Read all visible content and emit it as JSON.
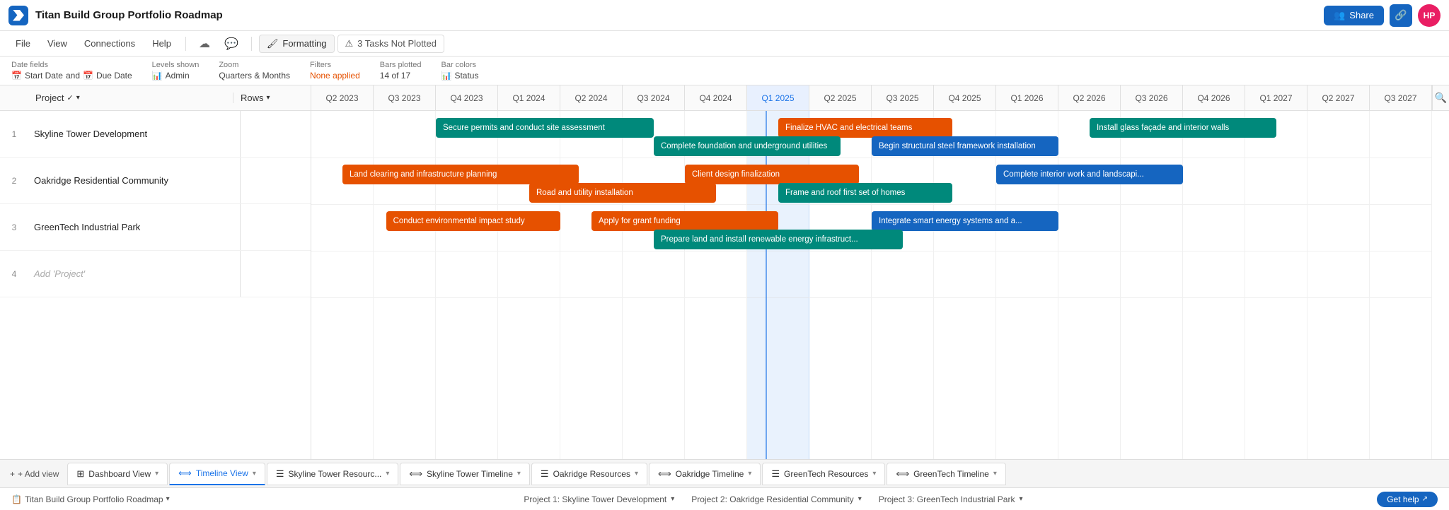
{
  "app": {
    "title": "Titan Build Group Portfolio Roadmap",
    "logo_alt": "App Logo"
  },
  "topbar": {
    "share_label": "Share",
    "avatar_initials": "HP"
  },
  "menubar": {
    "file": "File",
    "view": "View",
    "connections": "Connections",
    "help": "Help",
    "formatting": "Formatting",
    "not_plotted": "3 Tasks Not Plotted"
  },
  "infobar": {
    "date_fields_label": "Date fields",
    "date_fields_value": "Start Date",
    "date_fields_and": "and",
    "date_fields_due": "Due Date",
    "levels_label": "Levels shown",
    "levels_value": "Admin",
    "zoom_label": "Zoom",
    "zoom_value": "Quarters & Months",
    "filters_label": "Filters",
    "filters_value": "None applied",
    "bars_plotted_label": "Bars plotted",
    "bars_plotted_value": "14 of 17",
    "bar_colors_label": "Bar colors",
    "bar_colors_value": "Status"
  },
  "gantt": {
    "col_project": "Project",
    "col_rows": "Rows",
    "quarters": [
      {
        "label": "Q2 2023",
        "current": false
      },
      {
        "label": "Q3 2023",
        "current": false
      },
      {
        "label": "Q4 2023",
        "current": false
      },
      {
        "label": "Q1 2024",
        "current": false
      },
      {
        "label": "Q2 2024",
        "current": false
      },
      {
        "label": "Q3 2024",
        "current": false
      },
      {
        "label": "Q4 2024",
        "current": false
      },
      {
        "label": "Q1 2025",
        "current": true
      },
      {
        "label": "Q2 2025",
        "current": false
      },
      {
        "label": "Q3 2025",
        "current": false
      },
      {
        "label": "Q4 2025",
        "current": false
      },
      {
        "label": "Q1 2026",
        "current": false
      },
      {
        "label": "Q2 2026",
        "current": false
      },
      {
        "label": "Q3 2026",
        "current": false
      },
      {
        "label": "Q4 2026",
        "current": false
      },
      {
        "label": "Q1 2027",
        "current": false
      },
      {
        "label": "Q2 2027",
        "current": false
      },
      {
        "label": "Q3 2027",
        "current": false
      }
    ],
    "projects": [
      {
        "number": 1,
        "name": "Skyline Tower Development"
      },
      {
        "number": 2,
        "name": "Oakridge Residential Community"
      },
      {
        "number": 3,
        "name": "GreenTech Industrial Park"
      },
      {
        "number": 4,
        "name": ""
      }
    ],
    "add_project_placeholder": "Add 'Project'",
    "bars": [
      {
        "id": "b1",
        "label": "Secure permits and conduct site assessment",
        "color": "teal",
        "row": 0,
        "q_start": 2,
        "q_span": 3.5
      },
      {
        "id": "b2",
        "label": "Finalize HVAC and electrical teams",
        "color": "orange",
        "row": 0,
        "q_start": 7.5,
        "q_span": 2.8
      },
      {
        "id": "b3",
        "label": "Install glass façade and interior walls",
        "color": "teal",
        "row": 0,
        "q_start": 12.5,
        "q_span": 3
      },
      {
        "id": "b4",
        "label": "Complete foundation and underground utilities",
        "color": "teal",
        "row": 1,
        "q_start": 5.5,
        "q_span": 3
      },
      {
        "id": "b5",
        "label": "Begin structural steel framework installation",
        "color": "blue",
        "row": 1,
        "q_start": 9,
        "q_span": 3
      },
      {
        "id": "b6",
        "label": "Land clearing and infrastructure planning",
        "color": "orange",
        "row": 2,
        "q_start": 0.5,
        "q_span": 3.8
      },
      {
        "id": "b7",
        "label": "Client design finalization",
        "color": "orange",
        "row": 2,
        "q_start": 6,
        "q_span": 2.8
      },
      {
        "id": "b8",
        "label": "Complete interior work and landscapi...",
        "color": "blue",
        "row": 2,
        "q_start": 11,
        "q_span": 3
      },
      {
        "id": "b9",
        "label": "Road and utility installation",
        "color": "orange",
        "row": 3,
        "q_start": 3.5,
        "q_span": 3
      },
      {
        "id": "b10",
        "label": "Frame and roof first set of homes",
        "color": "teal",
        "row": 3,
        "q_start": 7.5,
        "q_span": 2.8
      },
      {
        "id": "b11",
        "label": "Conduct environmental impact study",
        "color": "orange",
        "row": 4,
        "q_start": 1.2,
        "q_span": 2.8
      },
      {
        "id": "b12",
        "label": "Apply for grant funding",
        "color": "orange",
        "row": 4,
        "q_start": 4.5,
        "q_span": 3
      },
      {
        "id": "b13",
        "label": "Integrate smart energy systems and a...",
        "color": "blue",
        "row": 4,
        "q_start": 9,
        "q_span": 3
      },
      {
        "id": "b14",
        "label": "Prepare land and install renewable energy infrastruct...",
        "color": "teal",
        "row": 5,
        "q_start": 5.5,
        "q_span": 4
      }
    ]
  },
  "bottom_tabs": [
    {
      "label": "Dashboard View",
      "icon": "grid",
      "active": false
    },
    {
      "label": "Timeline View",
      "icon": "timeline",
      "active": true
    },
    {
      "label": "Skyline Tower Resourc...",
      "icon": "resource",
      "active": false
    },
    {
      "label": "Skyline Tower Timeline",
      "icon": "timeline",
      "active": false
    },
    {
      "label": "Oakridge Resources",
      "icon": "resource",
      "active": false
    },
    {
      "label": "Oakridge Timeline",
      "icon": "timeline",
      "active": false
    },
    {
      "label": "GreenTech Resources",
      "icon": "resource",
      "active": false
    },
    {
      "label": "GreenTech Timeline",
      "icon": "timeline",
      "active": false
    }
  ],
  "add_view_label": "+ Add view",
  "status_bar": {
    "project1": "Project 1: Skyline Tower Development",
    "project2": "Project 2: Oakridge Residential Community",
    "project3": "Project 3: GreenTech Industrial Park",
    "portfolio": "Titan Build Group Portfolio Roadmap",
    "get_help": "Get help"
  }
}
